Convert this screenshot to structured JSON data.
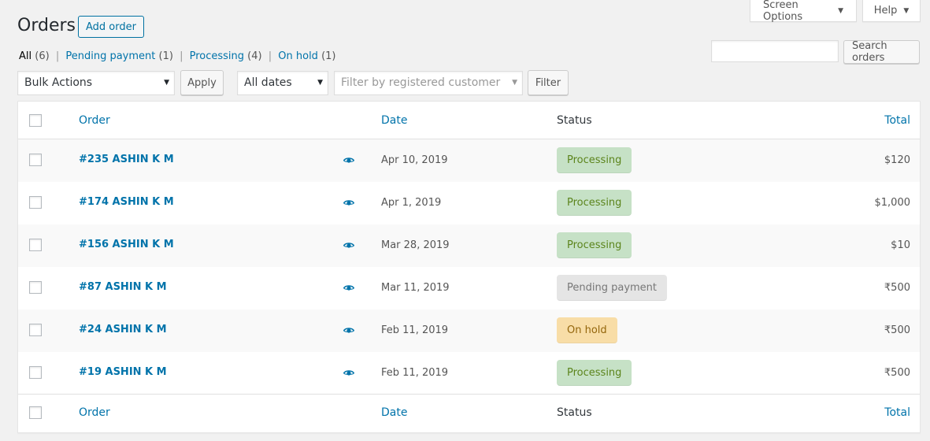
{
  "screen_tabs": {
    "screen_options": "Screen Options",
    "help": "Help"
  },
  "title": "Orders",
  "add_order": "Add order",
  "views": [
    {
      "label": "All",
      "count": "(6)"
    },
    {
      "label": "Pending payment",
      "count": "(1)"
    },
    {
      "label": "Processing",
      "count": "(4)"
    },
    {
      "label": "On hold",
      "count": "(1)"
    }
  ],
  "search": {
    "button": "Search orders",
    "value": ""
  },
  "filters": {
    "bulk_actions": "Bulk Actions",
    "apply": "Apply",
    "dates": "All dates",
    "customer_placeholder": "Filter by registered customer",
    "filter": "Filter"
  },
  "columns": {
    "order": "Order",
    "date": "Date",
    "status": "Status",
    "total": "Total"
  },
  "orders": [
    {
      "order": "#235 ASHIN K M",
      "date": "Apr 10, 2019",
      "status": "Processing",
      "status_type": "processing",
      "total": "$120"
    },
    {
      "order": "#174 ASHIN K M",
      "date": "Apr 1, 2019",
      "status": "Processing",
      "status_type": "processing",
      "total": "$1,000"
    },
    {
      "order": "#156 ASHIN K M",
      "date": "Mar 28, 2019",
      "status": "Processing",
      "status_type": "processing",
      "total": "$10"
    },
    {
      "order": "#87 ASHIN K M",
      "date": "Mar 11, 2019",
      "status": "Pending payment",
      "status_type": "pending",
      "total": "₹500"
    },
    {
      "order": "#24 ASHIN K M",
      "date": "Feb 11, 2019",
      "status": "On hold",
      "status_type": "onhold",
      "total": "₹500"
    },
    {
      "order": "#19 ASHIN K M",
      "date": "Feb 11, 2019",
      "status": "Processing",
      "status_type": "processing",
      "total": "₹500"
    }
  ],
  "colors": {
    "link": "#0073aa",
    "processing_bg": "#c6e1c6",
    "pending_bg": "#e5e5e5",
    "onhold_bg": "#f8dda7"
  }
}
